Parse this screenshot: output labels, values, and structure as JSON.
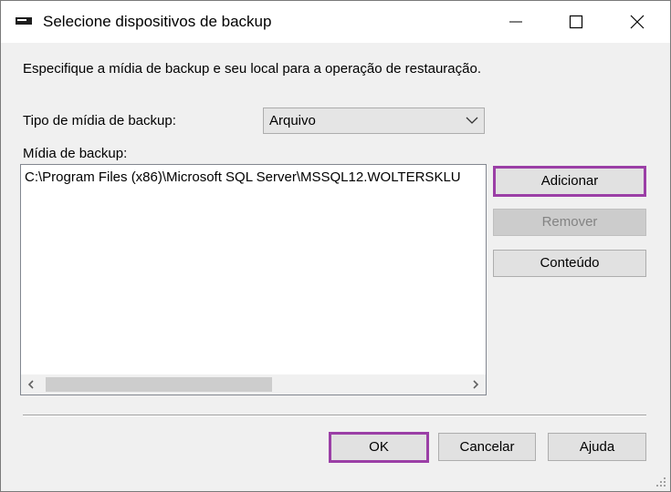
{
  "window": {
    "title": "Selecione dispositivos de backup",
    "icon": "drive-icon",
    "controls": [
      "minimize-icon",
      "maximize-icon",
      "close-icon"
    ]
  },
  "instructions": "Especifique a mídia de backup e seu local para a operação de restauração.",
  "media_type": {
    "label": "Tipo de mídia de backup:",
    "selected": "Arquivo"
  },
  "backup_media": {
    "label": "Mídia de backup:",
    "items": [
      "C:\\Program Files (x86)\\Microsoft SQL Server\\MSSQL12.WOLTERSKLU"
    ]
  },
  "side_buttons": {
    "add": "Adicionar",
    "remove": "Remover",
    "contents": "Conteúdo"
  },
  "footer_buttons": {
    "ok": "OK",
    "cancel": "Cancelar",
    "help": "Ajuda"
  },
  "colors": {
    "highlight": "#9b3fa6",
    "disabled_text": "#838383"
  }
}
